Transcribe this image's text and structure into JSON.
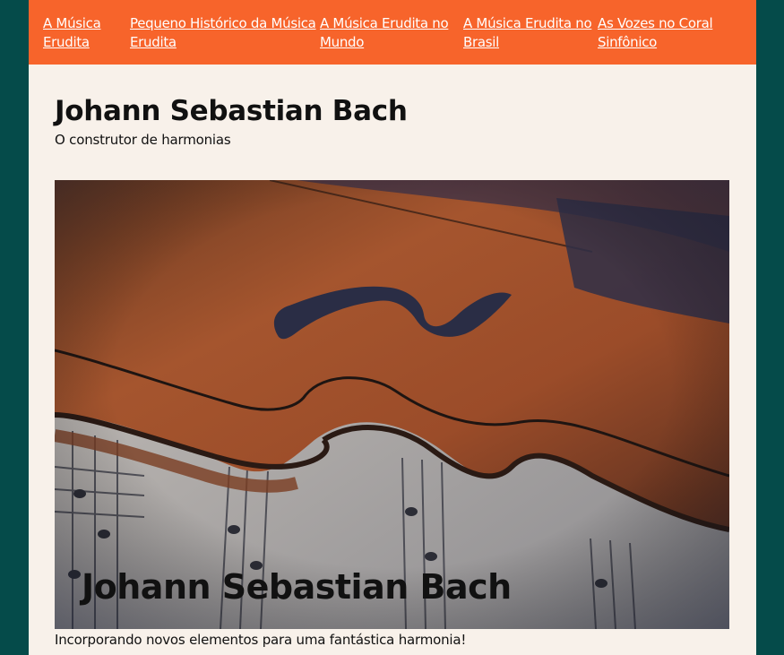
{
  "nav": {
    "items": [
      {
        "label": "A Música Erudita"
      },
      {
        "label": "Pequeno Histórico da Música Erudita"
      },
      {
        "label": "A Música Erudita no Mundo"
      },
      {
        "label": "A Música Erudita no Brasil"
      },
      {
        "label": "As Vozes no Coral Sinfônico"
      }
    ]
  },
  "header": {
    "title": "Johann Sebastian Bach",
    "subtitle": "O construtor de harmonias"
  },
  "hero": {
    "overlay_title": "Johann Sebastian Bach",
    "caption": "Incorporando novos elementos para uma fantástica harmonia!"
  },
  "colors": {
    "background": "#054b4a",
    "nav": "#f7642b",
    "page": "#f8f1ea"
  }
}
